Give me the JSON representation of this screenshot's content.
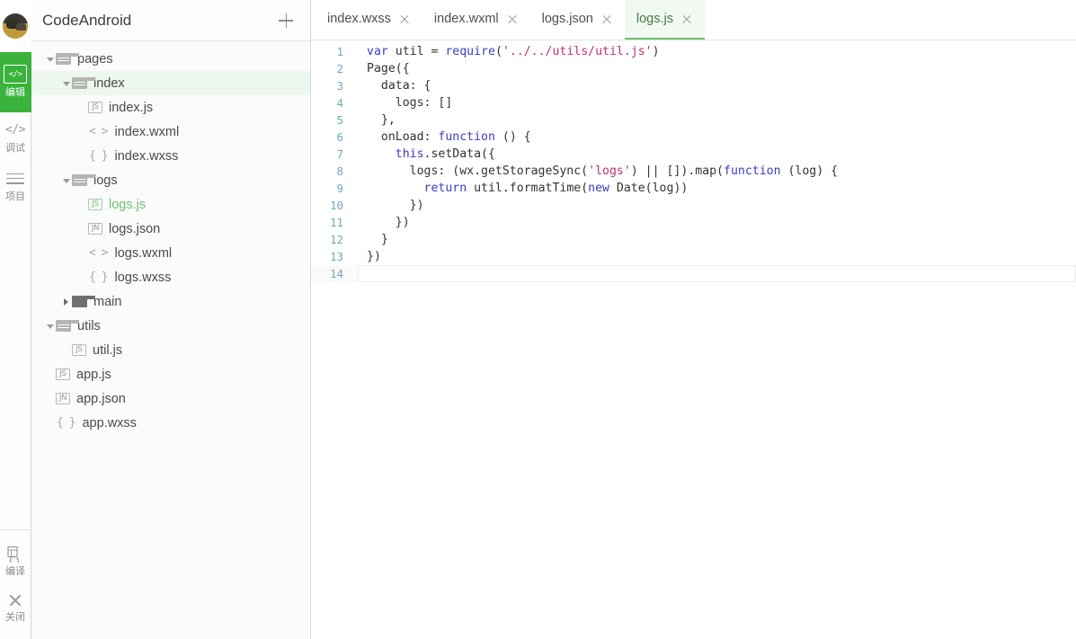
{
  "rail": {
    "avatar_name": "user-avatar",
    "items": [
      {
        "label": "编辑",
        "icon": "code-brackets-boxed-icon",
        "active": true
      },
      {
        "label": "调试",
        "icon": "code-brackets-icon",
        "active": false
      },
      {
        "label": "项目",
        "icon": "list-lines-icon",
        "active": false
      }
    ],
    "bottom_items": [
      {
        "label": "编译",
        "icon": "compile-refresh-icon"
      },
      {
        "label": "关闭",
        "icon": "close-x-icon"
      }
    ]
  },
  "project": {
    "title": "CodeAndroid",
    "add_button_name": "add-file-button"
  },
  "tree": [
    {
      "label": "pages",
      "depth": 0,
      "type": "folder",
      "state": "open",
      "selected": false
    },
    {
      "label": "index",
      "depth": 1,
      "type": "folder",
      "state": "open",
      "selected": true
    },
    {
      "label": "index.js",
      "depth": 2,
      "type": "js",
      "state": "leaf",
      "selected": false
    },
    {
      "label": "index.wxml",
      "depth": 2,
      "type": "wxml",
      "state": "leaf",
      "selected": false
    },
    {
      "label": "index.wxss",
      "depth": 2,
      "type": "wxss",
      "state": "leaf",
      "selected": false
    },
    {
      "label": "logs",
      "depth": 1,
      "type": "folder",
      "state": "open",
      "selected": false
    },
    {
      "label": "logs.js",
      "depth": 2,
      "type": "js",
      "state": "leaf",
      "selected": true
    },
    {
      "label": "logs.json",
      "depth": 2,
      "type": "json",
      "state": "leaf",
      "selected": false
    },
    {
      "label": "logs.wxml",
      "depth": 2,
      "type": "wxml",
      "state": "leaf",
      "selected": false
    },
    {
      "label": "logs.wxss",
      "depth": 2,
      "type": "wxss",
      "state": "leaf",
      "selected": false
    },
    {
      "label": "main",
      "depth": 1,
      "type": "folder",
      "state": "closed",
      "selected": false
    },
    {
      "label": "utils",
      "depth": 0,
      "type": "folder",
      "state": "open",
      "selected": false
    },
    {
      "label": "util.js",
      "depth": 1,
      "type": "js",
      "state": "leaf",
      "selected": false
    },
    {
      "label": "app.js",
      "depth": 0,
      "type": "js",
      "state": "leaf",
      "selected": false
    },
    {
      "label": "app.json",
      "depth": 0,
      "type": "json",
      "state": "leaf",
      "selected": false
    },
    {
      "label": "app.wxss",
      "depth": 0,
      "type": "wxss",
      "state": "leaf",
      "selected": false
    }
  ],
  "icon_glyphs": {
    "js": "JS",
    "json": "JN",
    "wxml": "< >",
    "wxss": "{ }"
  },
  "tabs": [
    {
      "label": "index.wxss",
      "active": false
    },
    {
      "label": "index.wxml",
      "active": false
    },
    {
      "label": "logs.json",
      "active": false
    },
    {
      "label": "logs.js",
      "active": true
    }
  ],
  "editor": {
    "active_file": "logs.js",
    "cursor_line": 14,
    "lines": [
      {
        "n": 1,
        "tokens": [
          {
            "t": "var",
            "c": "k"
          },
          {
            "t": " util = ",
            "c": "p"
          },
          {
            "t": "require",
            "c": "k"
          },
          {
            "t": "(",
            "c": "p"
          },
          {
            "t": "'../../utils/util.js'",
            "c": "s"
          },
          {
            "t": ")",
            "c": "p"
          }
        ]
      },
      {
        "n": 2,
        "tokens": [
          {
            "t": "Page({",
            "c": "p"
          }
        ]
      },
      {
        "n": 3,
        "tokens": [
          {
            "t": "  data: {",
            "c": "p"
          }
        ]
      },
      {
        "n": 4,
        "tokens": [
          {
            "t": "    logs: []",
            "c": "p"
          }
        ]
      },
      {
        "n": 5,
        "tokens": [
          {
            "t": "  },",
            "c": "p"
          }
        ]
      },
      {
        "n": 6,
        "tokens": [
          {
            "t": "  onLoad: ",
            "c": "p"
          },
          {
            "t": "function",
            "c": "k"
          },
          {
            "t": " () {",
            "c": "p"
          }
        ]
      },
      {
        "n": 7,
        "tokens": [
          {
            "t": "    ",
            "c": "p"
          },
          {
            "t": "this",
            "c": "k"
          },
          {
            "t": ".setData({",
            "c": "p"
          }
        ]
      },
      {
        "n": 8,
        "tokens": [
          {
            "t": "      logs: (wx.getStorageSync(",
            "c": "p"
          },
          {
            "t": "'logs'",
            "c": "s"
          },
          {
            "t": ") || []).map(",
            "c": "p"
          },
          {
            "t": "function",
            "c": "k"
          },
          {
            "t": " (log) {",
            "c": "p"
          }
        ]
      },
      {
        "n": 9,
        "tokens": [
          {
            "t": "        ",
            "c": "p"
          },
          {
            "t": "return",
            "c": "k"
          },
          {
            "t": " util.formatTime(",
            "c": "p"
          },
          {
            "t": "new",
            "c": "k"
          },
          {
            "t": " Date(log))",
            "c": "p"
          }
        ]
      },
      {
        "n": 10,
        "tokens": [
          {
            "t": "      })",
            "c": "p"
          }
        ]
      },
      {
        "n": 11,
        "tokens": [
          {
            "t": "    })",
            "c": "p"
          }
        ]
      },
      {
        "n": 12,
        "tokens": [
          {
            "t": "  }",
            "c": "p"
          }
        ]
      },
      {
        "n": 13,
        "tokens": [
          {
            "t": "})",
            "c": "p"
          }
        ]
      },
      {
        "n": 14,
        "tokens": [
          {
            "t": "",
            "c": "p"
          }
        ]
      }
    ]
  },
  "colors": {
    "accent_green": "#3ab33d",
    "tab_active_bg": "#f2f9f2",
    "tab_active_border": "#6fc071",
    "tree_sel_bg": "#eef7ee",
    "tree_sel_text": "#6cc16f",
    "keyword": "#3c3cc8",
    "string": "#c0326d",
    "linenum": "#6ea8bd"
  }
}
